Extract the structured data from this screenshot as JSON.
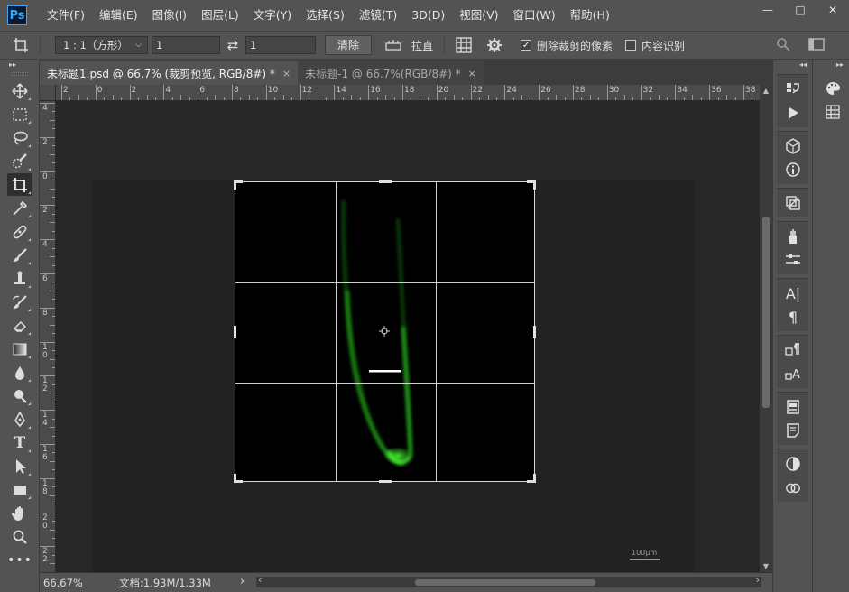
{
  "app": {
    "logo": "Ps"
  },
  "menu": [
    "文件(F)",
    "编辑(E)",
    "图像(I)",
    "图层(L)",
    "文字(Y)",
    "选择(S)",
    "滤镜(T)",
    "3D(D)",
    "视图(V)",
    "窗口(W)",
    "帮助(H)"
  ],
  "window_controls": {
    "minimize": "—",
    "maximize": "□",
    "close": "✕"
  },
  "options": {
    "ratio_value": "1 : 1（方形）",
    "width_value": "1",
    "height_value": "1",
    "swap_icon": "⇄",
    "clear_label": "清除",
    "straighten_label": "拉直",
    "delete_cropped_label": "删除裁剪的像素",
    "delete_cropped_checked": true,
    "content_aware_label": "内容识别",
    "content_aware_checked": false
  },
  "tabs": [
    {
      "label": "未标题1.psd @ 66.7% (裁剪预览, RGB/8#) *",
      "close": "×",
      "active": true
    },
    {
      "label": "未标题-1 @ 66.7%(RGB/8#) *",
      "close": "×",
      "active": false
    }
  ],
  "ruler_top_labels": [
    "2",
    "0",
    "2",
    "4",
    "6",
    "8",
    "10",
    "12",
    "14",
    "16",
    "18",
    "20",
    "22",
    "24",
    "26",
    "28",
    "30",
    "32",
    "34",
    "36",
    "38"
  ],
  "ruler_left_labels": [
    "4",
    "2",
    "0",
    "2",
    "4",
    "6",
    "8",
    "1\n0",
    "1\n2",
    "1\n4",
    "1\n6",
    "1\n8",
    "2\n0",
    "2\n2"
  ],
  "canvas": {
    "scale_bar_label": "100μm",
    "glow_color": "#22c21a"
  },
  "status": {
    "zoom": "66.67%",
    "doc_info": "文档:1.93M/1.33M",
    "arrow": "›"
  },
  "colors": {
    "accent": "#31a8ff",
    "panel_bg": "#535353",
    "canvas_bg": "#282828"
  }
}
